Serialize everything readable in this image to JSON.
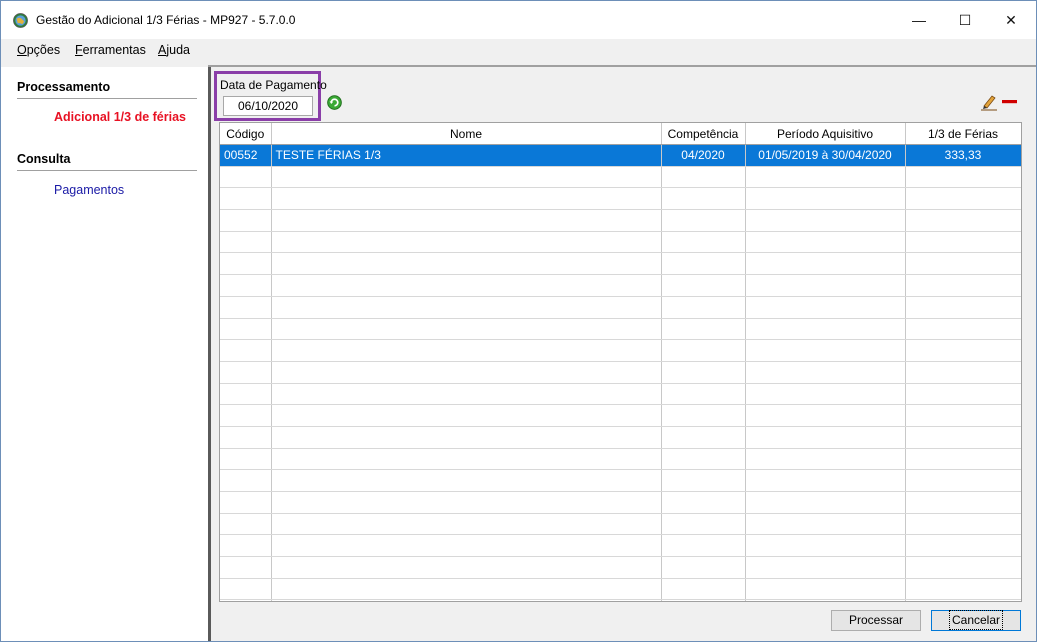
{
  "window": {
    "title": "Gestão do Adicional 1/3 Férias - MP927 - 5.7.0.0",
    "controls": {
      "minimize": "—",
      "maximize": "☐",
      "close": "✕"
    }
  },
  "menu": {
    "items": [
      {
        "accel": "O",
        "rest": "pções"
      },
      {
        "accel": "F",
        "rest": "erramentas"
      },
      {
        "accel": "A",
        "rest": "juda"
      }
    ]
  },
  "sidebar": {
    "processamento": {
      "title": "Processamento",
      "item": "Adicional 1/3 de férias"
    },
    "consulta": {
      "title": "Consulta",
      "item": "Pagamentos"
    }
  },
  "filter": {
    "label": "Data de Pagamento",
    "value": "06/10/2020"
  },
  "grid": {
    "columns": [
      "Código",
      "Nome",
      "Competência",
      "Período Aquisitivo",
      "1/3 de Férias"
    ],
    "rows": [
      {
        "codigo": "00552",
        "nome": "TESTE FÉRIAS 1/3",
        "competencia": "04/2020",
        "periodo": "01/05/2019 à 30/04/2020",
        "valor": "333,33",
        "selected": true
      }
    ]
  },
  "buttons": {
    "process": "Processar",
    "cancel": "Cancelar"
  },
  "colors": {
    "accent": "#0a78d7",
    "highlight_link": "#e81123",
    "link": "#1a1aa6",
    "focus_box": "#8a3ea8"
  },
  "icons": [
    "app-globe-icon",
    "refresh-icon",
    "edit-pencil-icon",
    "remove-minus-icon"
  ]
}
